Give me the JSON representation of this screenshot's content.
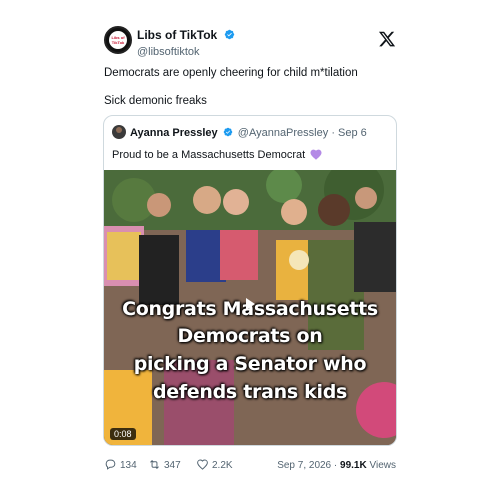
{
  "tweet": {
    "author": {
      "name": "Libs of TikTok",
      "handle": "@libsoftiktok",
      "avatar_text": "Libs of TikTok",
      "verified": true
    },
    "lines": [
      "Democrats are openly cheering for child m*tilation",
      "Sick demonic freaks"
    ],
    "date": "Sep 7, 2026",
    "views_count": "99.1K",
    "views_label": "Views",
    "separator": "·",
    "stats": {
      "replies": "134",
      "reposts": "347",
      "likes": "2.2K"
    }
  },
  "quote": {
    "name": "Ayanna Pressley",
    "handle": "@AyannaPressley",
    "separator": "·",
    "date": "Sep 6",
    "text": "Proud to be a Massachusetts Democrat",
    "video": {
      "caption_lines": [
        "Congrats Massachusetts",
        "Democrats on",
        "picking a Senator who",
        "defends trans kids"
      ],
      "duration": "0:08"
    }
  },
  "colors": {
    "verified": "#1d9bf0",
    "text": "#0f1419",
    "muted": "#536471",
    "border": "#cfd9de",
    "heart": "#b48ae6"
  },
  "icons": {
    "x_logo": "x-logo-icon",
    "reply": "reply-icon",
    "repost": "repost-icon",
    "like": "like-icon",
    "play": "play-icon"
  }
}
